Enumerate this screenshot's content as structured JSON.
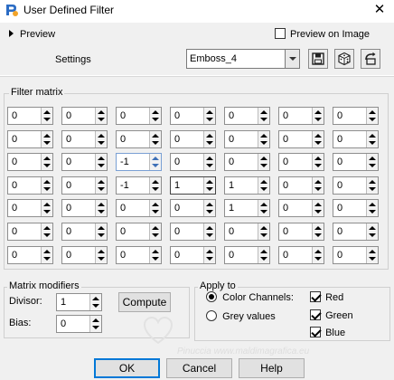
{
  "window": {
    "title": "User Defined Filter",
    "close_glyph": "✕"
  },
  "preview": {
    "label": "Preview",
    "preview_on_image_label": "Preview on Image",
    "preview_on_image_checked": false
  },
  "settings": {
    "label": "Settings",
    "preset_value": "Emboss_4",
    "buttons": [
      "save-icon",
      "randomize-dice-icon",
      "reset-icon"
    ]
  },
  "filter_matrix": {
    "label": "Filter matrix",
    "rows": [
      [
        "0",
        "0",
        "0",
        "0",
        "0",
        "0",
        "0"
      ],
      [
        "0",
        "0",
        "0",
        "0",
        "0",
        "0",
        "0"
      ],
      [
        "0",
        "0",
        "-1",
        "0",
        "0",
        "0",
        "0"
      ],
      [
        "0",
        "0",
        "-1",
        "1",
        "1",
        "0",
        "0"
      ],
      [
        "0",
        "0",
        "0",
        "0",
        "1",
        "0",
        "0"
      ],
      [
        "0",
        "0",
        "0",
        "0",
        "0",
        "0",
        "0"
      ],
      [
        "0",
        "0",
        "0",
        "0",
        "0",
        "0",
        "0"
      ]
    ]
  },
  "matrix_modifiers": {
    "label": "Matrix modifiers",
    "divisor_label": "Divisor:",
    "divisor_value": "1",
    "compute_label": "Compute",
    "bias_label": "Bias:",
    "bias_value": "0"
  },
  "apply_to": {
    "label": "Apply to",
    "color_channels_label": "Color Channels:",
    "color_channels_selected": true,
    "grey_values_label": "Grey values",
    "channels": [
      {
        "label": "Red",
        "checked": true
      },
      {
        "label": "Green",
        "checked": true
      },
      {
        "label": "Blue",
        "checked": true
      }
    ]
  },
  "footer": {
    "ok_label": "OK",
    "cancel_label": "Cancel",
    "help_label": "Help"
  },
  "watermark": {
    "text": "Pinuccia www.maldimagrafica.eu"
  }
}
